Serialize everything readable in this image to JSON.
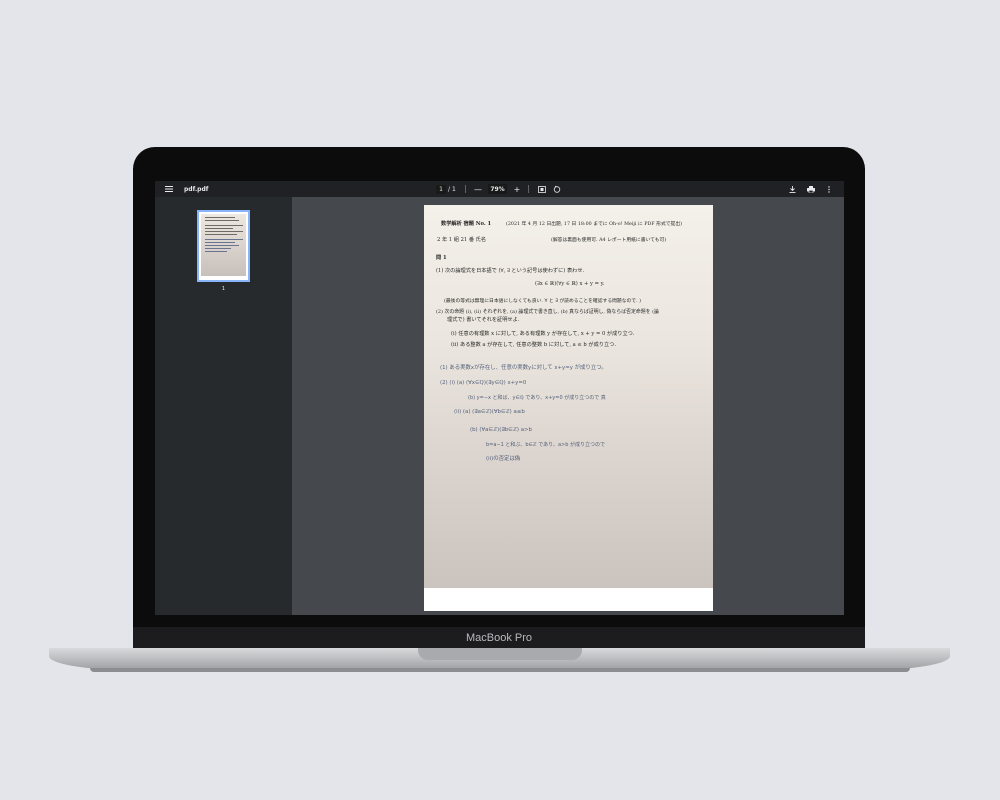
{
  "device": {
    "brand": "MacBook Pro"
  },
  "toolbar": {
    "title": "pdf.pdf",
    "page_current": "1",
    "page_sep": "/",
    "page_total": "1",
    "zoom_minus": "—",
    "zoom": "79%",
    "zoom_plus": "+"
  },
  "sidebar": {
    "thumb_label": "1"
  },
  "document": {
    "header": "数学解析 宿題 No. 1",
    "header_note": "(2021 年 4 月 12 日出題, 17 日 18:00 までに Oh-o! Meiji に PDF 形式で提出)",
    "name_line": "2 年 1 組 21 番  氏名",
    "name_note": "(解答は裏面も使用可. A4 レポート用紙に書いても可)",
    "q_title": "問 1",
    "q1": "(1) 次の論理式を日本語で (∀, ∃ という記号は使わずに) 表わせ.",
    "q1_formula": "(∃x ∈ ℝ)(∀y ∈ ℝ)   x + y = y.",
    "q1_note": "(最後の等式は無理に日本語にしなくても良い. ∀ と ∃ が読めることを確認する問題なので. )",
    "q2": "(2) 次の命題 (i), (ii) それぞれを, (a) 論理式で書き直し, (b) 真ならば証明し, 偽ならば否定命題を (論",
    "q2b": "理式で) 書いてそれを証明せよ.",
    "q2_i": "(i) 任意の有理数 x に対して, ある有理数 y が存在して, x + y = 0 が成り立つ.",
    "q2_ii": "(ii) ある整数 a が存在して, 任意の整数 b に対して, a ≤ b が成り立つ.",
    "hw1": "(1) ある実数xが存在し、任意の実数yに対して x+y=y が成り立つ。",
    "hw2": "(2) (i) (a) (∀x∈ℚ)(∃y∈ℚ) x+y=0",
    "hw3": "(b) y=−x と和ば、y∈ℚ であり、x+y=0 が成り立つので 真",
    "hw4": "(ii) (a) (∃a∈ℤ)(∀b∈ℤ) a≤b",
    "hw5": "(b) (∀a∈ℤ)(∃b∈ℤ) a>b",
    "hw6": "b=a−1 と和ぶ、b∈ℤ であり、a>b が成り立つので",
    "hw7": "(ii)の否定は偽"
  }
}
